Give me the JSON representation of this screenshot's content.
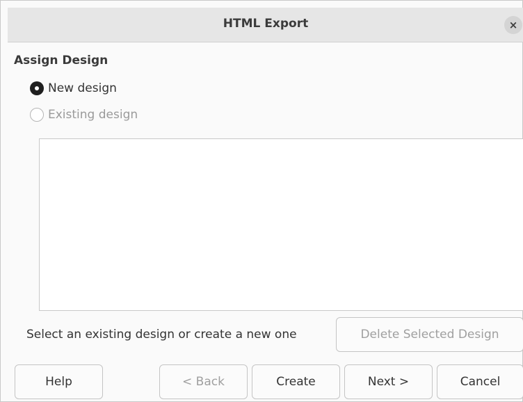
{
  "window": {
    "title": "HTML Export",
    "close_symbol": "×"
  },
  "assign_design": {
    "heading": "Assign Design",
    "options": [
      {
        "label": "New design",
        "checked": true,
        "enabled": true
      },
      {
        "label": "Existing design",
        "checked": false,
        "enabled": false
      }
    ],
    "designs": [],
    "hint": "Select an existing design or create a new one",
    "delete_button": {
      "label": "Delete Selected Design",
      "enabled": false
    }
  },
  "footer": {
    "help": {
      "label": "Help",
      "enabled": true
    },
    "back": {
      "label": "< Back",
      "enabled": false
    },
    "create": {
      "label": "Create",
      "enabled": true
    },
    "next": {
      "label": "Next >",
      "enabled": true
    },
    "cancel": {
      "label": "Cancel",
      "enabled": true
    }
  },
  "icons": {
    "close": "close-icon",
    "radio_checked": "radio-checked-icon",
    "radio_unchecked": "radio-unchecked-icon"
  }
}
